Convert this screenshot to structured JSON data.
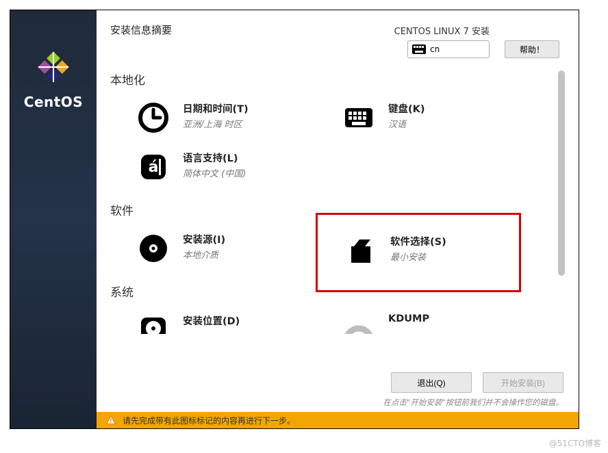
{
  "brand": "CentOS",
  "header": {
    "title": "安装信息摘要",
    "install_label": "CENTOS LINUX 7 安装",
    "lang_code": "cn",
    "help_label": "帮助！"
  },
  "sections": {
    "local": "本地化",
    "software": "软件",
    "system": "系统"
  },
  "items": {
    "datetime": {
      "title": "日期和时间(T)",
      "sub": "亚洲/上海 时区"
    },
    "keyboard": {
      "title": "键盘(K)",
      "sub": "汉语"
    },
    "lang": {
      "title": "语言支持(L)",
      "sub": "简体中文 (中国)"
    },
    "source": {
      "title": "安装源(I)",
      "sub": "本地介质"
    },
    "software": {
      "title": "软件选择(S)",
      "sub": "最小安装"
    },
    "dest": {
      "title": "安装位置(D)",
      "sub": ""
    },
    "kdump": {
      "title": "KDUMP",
      "sub": ""
    }
  },
  "buttons": {
    "quit": "退出(Q)",
    "begin": "开始安装(B)"
  },
  "hint": "在点击\"开始安装\"按钮前我们并不会操作您的磁盘。",
  "warning": "请先完成带有此图标标记的内容再进行下一步。",
  "watermark": "@51CTO博客"
}
